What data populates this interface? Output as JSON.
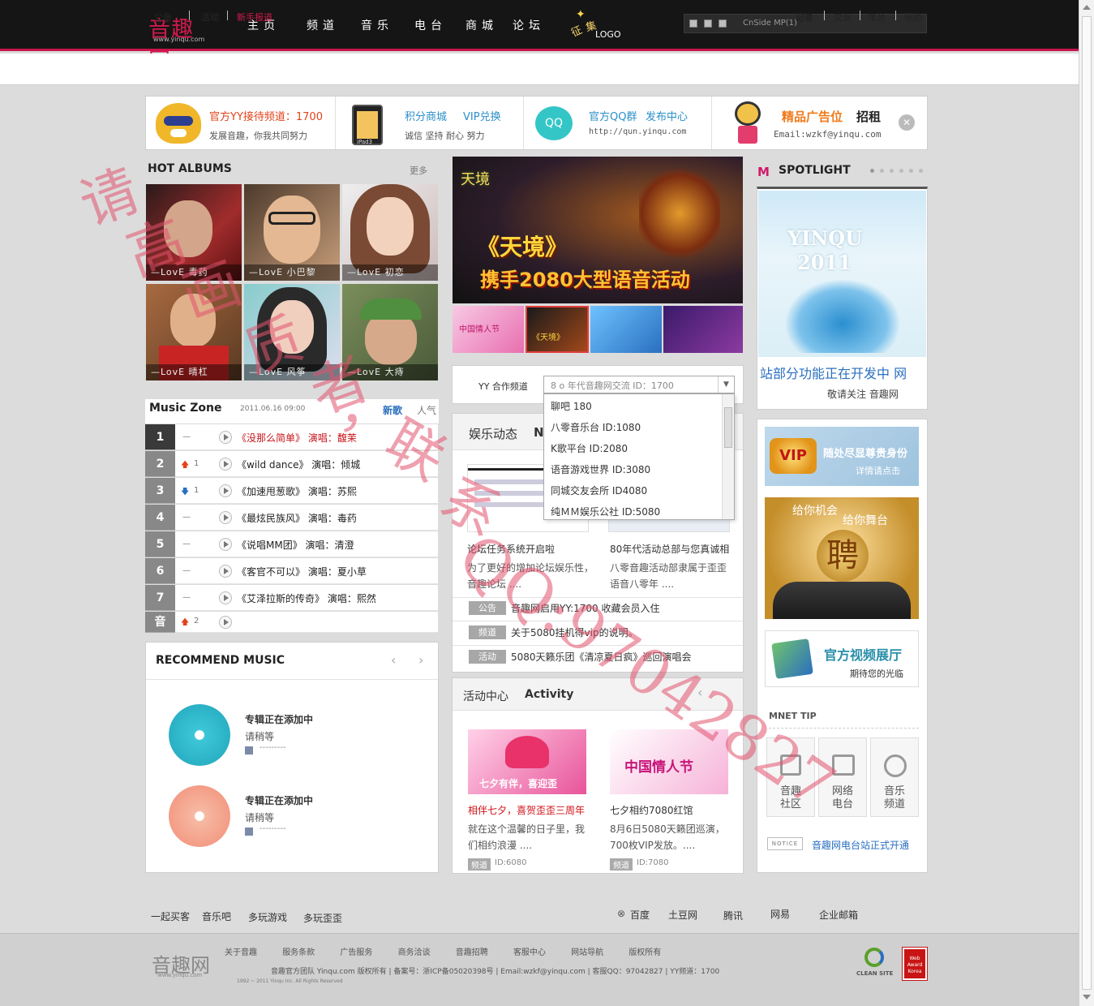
{
  "header": {
    "logo_text": "音趣网",
    "logo_sub": "www.yinqu.com",
    "nav": [
      "主页",
      "频道",
      "音乐",
      "电台",
      "商城",
      "论坛"
    ],
    "zhengji": {
      "zheng": "征",
      "ji": "集",
      "logo": "LOGO"
    },
    "player_text": "CnSide MP(1)"
  },
  "subnav": {
    "left": [
      "公告",
      "活动",
      "新手报道"
    ],
    "right": [
      "记者",
      "交友",
      "电台",
      "帮助"
    ]
  },
  "promo": [
    {
      "title": "官方YY接待频道：1700",
      "sub": "发展音趣，你我共同努力"
    },
    {
      "title": "积分商城",
      "title2": "VIP兑换",
      "sub": "诚信 坚持 耐心 努力",
      "icon": "iPad3"
    },
    {
      "title": "官方QQ群",
      "title2": "发布中心",
      "sub": "http://qun.yinqu.com",
      "icon": "QQ"
    },
    {
      "title": "精品广告位",
      "title2": "招租",
      "sub": "Email:wzkf@yinqu.com"
    }
  ],
  "hot_albums": {
    "title": "HOT ALBUMS",
    "more": "更多",
    "items": [
      {
        "cap": "—LovE 毒药"
      },
      {
        "cap": "—LovE 小巴黎"
      },
      {
        "cap": "—LovE 初恋"
      },
      {
        "cap": "—LovE 晴杠"
      },
      {
        "cap": "—LovE 风筝"
      },
      {
        "cap": "—LovE 大痔"
      }
    ]
  },
  "banner": {
    "logo": "天境",
    "title": "《天境》",
    "subtitle": "携手2080大型语音活动",
    "thumbs": [
      "中国情人节",
      "《天境》",
      "",
      ""
    ]
  },
  "yy_select": {
    "label": "YY 合作频道",
    "value": "8 o 年代音趣网交流 ID：1700",
    "options": [
      "聊吧 180",
      "八零音乐台 ID:1080",
      "K歌平台 ID:2080",
      "语音游戏世界 ID:3080",
      "同城交友会所 ID4080",
      "纯ＭＭ娱乐公社 ID:5080"
    ]
  },
  "music_zone": {
    "title": "Music Zone",
    "date": "2011.06.16 09:00",
    "tab_new": "新歌",
    "tab_hot": "人气",
    "rows": [
      {
        "num": "1",
        "trend": "—",
        "song": "《没那么简单》 演唱：馥茉"
      },
      {
        "num": "2",
        "trend": "1",
        "song": "《wild dance》 演唱：倾城"
      },
      {
        "num": "3",
        "trend": "1",
        "song": "《加速甩葱歌》 演唱：苏熙"
      },
      {
        "num": "4",
        "trend": "—",
        "song": "《最炫民族风》 演唱：毒药"
      },
      {
        "num": "5",
        "trend": "—",
        "song": "《说唱MM团》 演唱：清澄"
      },
      {
        "num": "6",
        "trend": "—",
        "song": "《客官不可以》 演唱：夏小草"
      },
      {
        "num": "7",
        "trend": "—",
        "song": "《艾泽拉斯的传奇》 演唱：熙然"
      },
      {
        "num": "音",
        "trend": "2",
        "song": ""
      }
    ]
  },
  "recommend": {
    "title": "RECOMMEND MUSIC",
    "items": [
      {
        "title": "专辑正在添加中",
        "sub": "请稍等",
        "meta": "---------"
      },
      {
        "title": "专辑正在添加中",
        "sub": "请稍等",
        "meta": "---------"
      }
    ]
  },
  "ent_news": {
    "title": "娱乐动态",
    "title_en": "N",
    "left": {
      "headline": "论坛任务系统开启啦",
      "desc": "为了更好的增加论坛娱乐性，音趣论坛 ...."
    },
    "right": {
      "headline": "80年代活动总部与您真诚相",
      "desc": "八零音趣活动部隶属于歪歪语音八零年 ...."
    },
    "lines": [
      {
        "tag": "公告",
        "text": "音趣网启用YY:1700 收藏会员入住"
      },
      {
        "tag": "频道",
        "text": "关于5080挂机得vip的说明。"
      },
      {
        "tag": "活动",
        "text": "5080天籁乐团《清凉夏日疯》巡回演唱会"
      }
    ]
  },
  "activity": {
    "title": "活动中心",
    "title_en": "Activity",
    "items": [
      {
        "headline": "相伴七夕，喜贺歪歪三周年",
        "desc": "就在这个温馨的日子里，我们相约浪漫 ....",
        "tag": "频道",
        "id": "ID:6080",
        "img_text": "七夕有伴，喜迎歪"
      },
      {
        "headline": "七夕相约7080红馆",
        "desc": "8月6日5080天籁团巡演，700枚VIP发放。....",
        "tag": "频道",
        "id": "ID:7080",
        "img_text": "中国情人节"
      }
    ]
  },
  "spotlight": {
    "title": "SPOTLIGHT",
    "img_text1": "YINQU",
    "img_text2": "2011",
    "caption": "站部分功能正在开发中 网",
    "sub": "敬请关注 音趣网"
  },
  "side": {
    "vip_title": "随处尽显尊贵身份",
    "vip_sub": "详情请点击",
    "vip_badge": "VIP",
    "recruit_line1": "给你机会",
    "recruit_line2": "给你舞台",
    "recruit_char": "聘",
    "video_title": "官方视频展厅",
    "video_sub": "期待您的光临",
    "mnet_title": "MNET TIP",
    "tips": [
      "音趣社区",
      "网络电台",
      "音乐频道"
    ],
    "notice_tag": "NOTICE",
    "notice_text": "音趣网电台站正式开通"
  },
  "footer": {
    "links_left": [
      "一起买客",
      "音乐吧",
      "多玩游戏",
      "多玩歪歪"
    ],
    "links_right": [
      "百度",
      "土豆网",
      "腾讯",
      "网易",
      "企业邮箱"
    ],
    "logo_text": "音趣网",
    "logo_sub": "www.yinqu.com",
    "bottom_links": [
      "关于音趣",
      "服务条款",
      "广告服务",
      "商务洽谈",
      "音趣招聘",
      "客服中心",
      "网站导航",
      "版权所有"
    ],
    "copyright": "音趣官方团队  Yinqu.com 版权所有 | 备案号：浙ICP备05020398号 | Email:wzkf@yinqu.com | 客服QQ：97042827 | YY频道：1700",
    "copyright2": "1992 ~ 2011 Yinqu Inc. All Rights Reserved",
    "badge1": "CLEAN SITE",
    "badge2": "Web Award Korea"
  },
  "watermark": [
    "请",
    "高",
    "画",
    "质",
    "者",
    "，",
    "联",
    "系",
    "QQ:97042827"
  ],
  "colors": {
    "brand": "#c8144a",
    "orange": "#e2431a",
    "blue": "#2a8fc9",
    "dark": "#151515"
  }
}
